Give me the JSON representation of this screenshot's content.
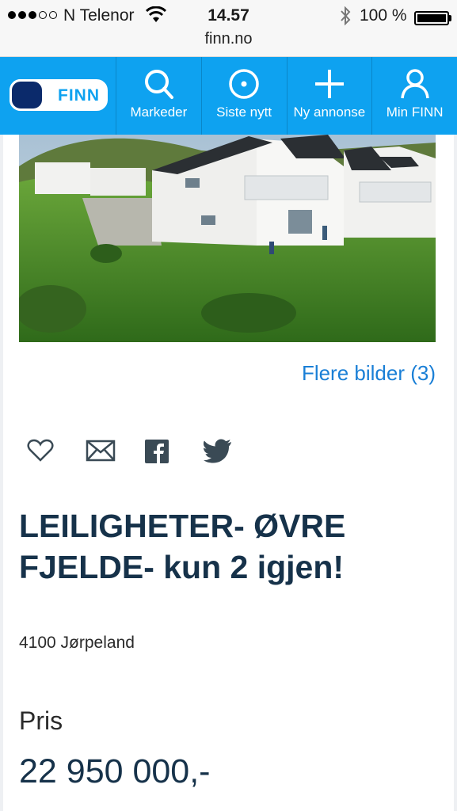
{
  "status_bar": {
    "carrier": "N Telenor",
    "time": "14.57",
    "battery": "100 %",
    "url": "finn.no"
  },
  "nav": {
    "logo_text": "FINN",
    "items": [
      {
        "label": "Markeder",
        "icon": "search-icon"
      },
      {
        "label": "Siste nytt",
        "icon": "target-icon"
      },
      {
        "label": "Ny annonse",
        "icon": "plus-icon"
      },
      {
        "label": "Min FINN",
        "icon": "person-icon"
      }
    ]
  },
  "listing": {
    "more_images": "Flere bilder (3)",
    "title": "LEILIGHETER- ØVRE FJELDE- kun 2 igjen!",
    "address": "4100 Jørpeland",
    "price_label": "Pris",
    "price": "22 950 000,-"
  },
  "share_icons": [
    "heart-icon",
    "mail-icon",
    "facebook-icon",
    "twitter-icon"
  ],
  "colors": {
    "brand": "#0ea2f0",
    "link": "#1a7fd6",
    "logo_dark": "#0b2a6b"
  }
}
